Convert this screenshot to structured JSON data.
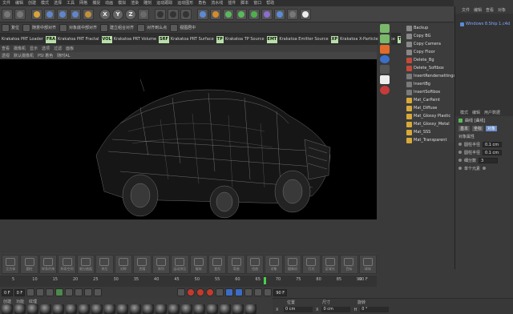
{
  "menu": [
    "文件",
    "编辑",
    "创建",
    "模式",
    "选择",
    "工具",
    "网格",
    "捕捉",
    "动画",
    "模拟",
    "渲染",
    "雕刻",
    "运动跟踪",
    "运动图形",
    "角色",
    "流水线",
    "插件",
    "脚本",
    "窗口",
    "帮助"
  ],
  "toolbar": {
    "items": [
      {
        "icon": "undo-icon",
        "color": "#777"
      },
      {
        "icon": "redo-icon",
        "color": "#777"
      },
      {
        "icon": "live-selection-icon",
        "color": "#d9a23a"
      },
      {
        "icon": "move-icon",
        "color": "#5f86c9"
      },
      {
        "icon": "scale-icon",
        "color": "#5f86c9"
      },
      {
        "icon": "rotate-icon",
        "color": "#5f86c9"
      },
      {
        "icon": "recent-tools-icon",
        "color": "#c2903a"
      },
      {
        "icon": "x-axis-icon",
        "label": "X",
        "color": "#666"
      },
      {
        "icon": "y-axis-icon",
        "label": "Y",
        "color": "#666"
      },
      {
        "icon": "z-axis-icon",
        "label": "Z",
        "color": "#666"
      },
      {
        "icon": "world-coordinate-icon",
        "color": "#6a6a6a"
      },
      {
        "icon": "render-view-icon",
        "color": "#333"
      },
      {
        "icon": "render-picture-viewer-icon",
        "color": "#333"
      },
      {
        "icon": "edit-render-settings-icon",
        "color": "#333"
      },
      {
        "icon": "cube-icon",
        "color": "#5a8bd6"
      },
      {
        "icon": "pen-icon",
        "color": "#d48b2e"
      },
      {
        "icon": "subdivision-icon",
        "color": "#5ab95a"
      },
      {
        "icon": "array-icon",
        "color": "#5ab95a"
      },
      {
        "icon": "cloner-icon",
        "color": "#4db04d"
      },
      {
        "icon": "deformer-icon",
        "color": "#8a6ed0"
      },
      {
        "icon": "floor-icon",
        "color": "#5a8bd6"
      },
      {
        "icon": "camera-icon",
        "color": "#777"
      },
      {
        "icon": "light-icon",
        "color": "#eee"
      }
    ]
  },
  "toolbar2": [
    {
      "icon": "reset-icon",
      "label": "复位"
    },
    {
      "icon": "snap-icon",
      "label": "随意中部对齐"
    },
    {
      "icon": "align-icon",
      "label": "对象底中部对齐"
    },
    {
      "icon": "center-icon",
      "label": "建立组合对齐"
    },
    {
      "icon": "object-center-icon",
      "label": "对齐到么点"
    },
    {
      "icon": "view-center-icon",
      "label": "视图居中"
    }
  ],
  "plugins": [
    {
      "tag": "",
      "label": "Krakatoa PRT Loader"
    },
    {
      "tag": "FRA",
      "label": "Krakatoa PRT Fractal"
    },
    {
      "tag": "VOL",
      "label": "Krakatoa PRT Volume"
    },
    {
      "tag": "SRF",
      "label": "Krakatoa PRT Surface"
    },
    {
      "tag": "TP",
      "label": "Krakatoa TP Source"
    },
    {
      "tag": "EMT",
      "label": "Krakatoa Emitter Source"
    },
    {
      "tag": "XP",
      "label": "Krakatoa X-Particles Source"
    },
    {
      "tag": "TFD",
      "label": "Krakato"
    }
  ],
  "viewport_header": [
    "查看",
    "摄像机",
    "显示",
    "选项",
    "过滤",
    "面板"
  ],
  "viewport_sub": [
    "透视",
    "默认摄像机",
    "PSI 着色",
    "随时AL"
  ],
  "sidestrip": [
    {
      "icon": "script-icon",
      "color": "#7ab86b"
    },
    {
      "icon": "target-icon",
      "color": "#7ab86b"
    },
    {
      "icon": "s-icon",
      "color": "#e06b2a"
    },
    {
      "icon": "globe-icon",
      "color": "#3b6fc9"
    },
    {
      "icon": "drop-icon",
      "color": "#555"
    },
    {
      "icon": "heart-icon",
      "color": "#eee"
    },
    {
      "icon": "circle-icon",
      "color": "#c63b3b"
    }
  ],
  "script_list": [
    {
      "icon": "script-icon",
      "label": "Backup",
      "color": "#888"
    },
    {
      "icon": "script-icon",
      "label": "Copy BG",
      "color": "#888"
    },
    {
      "icon": "script-icon",
      "label": "Copy Camera",
      "color": "#888"
    },
    {
      "icon": "script-icon",
      "label": "Copy Floor",
      "color": "#888"
    },
    {
      "icon": "script-icon",
      "label": "Delete_Bg",
      "color": "#c24a3a"
    },
    {
      "icon": "script-icon",
      "label": "Delete_Softbox",
      "color": "#c24a3a"
    },
    {
      "icon": "script-icon",
      "label": "InsertRendersettings",
      "color": "#7a7a7a"
    },
    {
      "icon": "script-icon",
      "label": "InsertBg",
      "color": "#7a7a7a"
    },
    {
      "icon": "script-icon",
      "label": "InsertSoftbox",
      "color": "#7a7a7a"
    },
    {
      "icon": "material-icon",
      "label": "Mat_CarPaint",
      "color": "#d8a93a"
    },
    {
      "icon": "material-icon",
      "label": "Mat_Diffuse",
      "color": "#d8a93a"
    },
    {
      "icon": "material-icon",
      "label": "Mat_Glossy Plastic",
      "color": "#d8a93a"
    },
    {
      "icon": "material-icon",
      "label": "Mat_Glossy_Metal",
      "color": "#d8a93a"
    },
    {
      "icon": "material-icon",
      "label": "Mat_SSS",
      "color": "#d8a93a"
    },
    {
      "icon": "material-icon",
      "label": "Mat_Transparent",
      "color": "#d8a93a"
    }
  ],
  "object_panel": {
    "tabs": [
      "文件",
      "编辑",
      "查看",
      "对象"
    ],
    "object_name": "Windows 8.Ship 1.c4d"
  },
  "attr_panel": {
    "tabs": [
      "模式",
      "编辑",
      "用户数据"
    ],
    "title": "曲线 [曲线]",
    "mode_buttons": [
      "基本",
      "坐标",
      "对象"
    ],
    "section": "对象属性",
    "rows": [
      {
        "label": "圆柱半径",
        "value": "0.1 cm"
      },
      {
        "label": "圆柱半径",
        "value": "0.1 cm"
      },
      {
        "label": "细分数",
        "value": "3"
      },
      {
        "label": "单个元素",
        "value": ""
      }
    ]
  },
  "shelf": [
    "立方体",
    "圆柱",
    "样条约束",
    "样条空间",
    "细分曲面",
    "挤压",
    "对称",
    "克隆",
    "阵列",
    "运动挤压",
    "破碎",
    "变形",
    "弯曲",
    "扭曲",
    "对象",
    "摄像机",
    "灯光",
    "区域光",
    "目标",
    "球体"
  ],
  "timeline": {
    "ticks": [
      "5",
      "10",
      "15",
      "20",
      "25",
      "30",
      "35",
      "40",
      "45",
      "50",
      "55",
      "60",
      "65",
      "70",
      "75",
      "80",
      "85",
      "90"
    ],
    "end_frame": "90 F",
    "current_frame_position": 0.7
  },
  "transport": {
    "start": "0 F",
    "end": "90 F",
    "current": "0 F"
  },
  "material_bar": {
    "tabs": [
      "创建",
      "功能",
      "纹理"
    ],
    "count": 20
  },
  "coords": {
    "headers": [
      "位置",
      "尺寸",
      "旋转"
    ],
    "x": {
      "label": "X",
      "pos": "0 cm",
      "size": "0 cm",
      "rot_label": "H",
      "rot": "0 °"
    },
    "y": {
      "label": "Y",
      "pos": "0 cm",
      "size": "0 cm",
      "rot_label": "P",
      "rot": "0 °"
    }
  }
}
